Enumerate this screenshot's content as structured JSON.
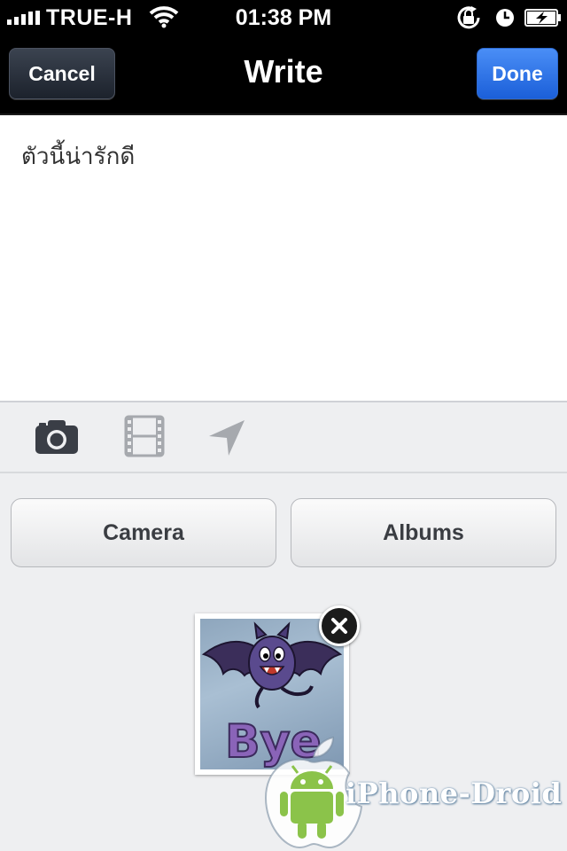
{
  "status_bar": {
    "carrier": "TRUE-H",
    "time": "01:38 PM",
    "icons": [
      "signal-icon",
      "wifi-icon",
      "rotation-lock-icon",
      "alarm-icon",
      "battery-charging-icon"
    ]
  },
  "navbar": {
    "title": "Write",
    "cancel_label": "Cancel",
    "done_label": "Done"
  },
  "compose": {
    "text": "ตัวนี้น่ารักดี"
  },
  "attach_toolbar": {
    "icons": [
      "camera-icon",
      "video-icon",
      "location-icon"
    ]
  },
  "picker": {
    "camera_label": "Camera",
    "albums_label": "Albums"
  },
  "attachment": {
    "image_text": "Bye"
  },
  "watermark": {
    "text": "iPhone-Droid"
  },
  "colors": {
    "done_blue": "#1b5fd9",
    "nav_black": "#000000",
    "panel_gray": "#eeeff1"
  }
}
